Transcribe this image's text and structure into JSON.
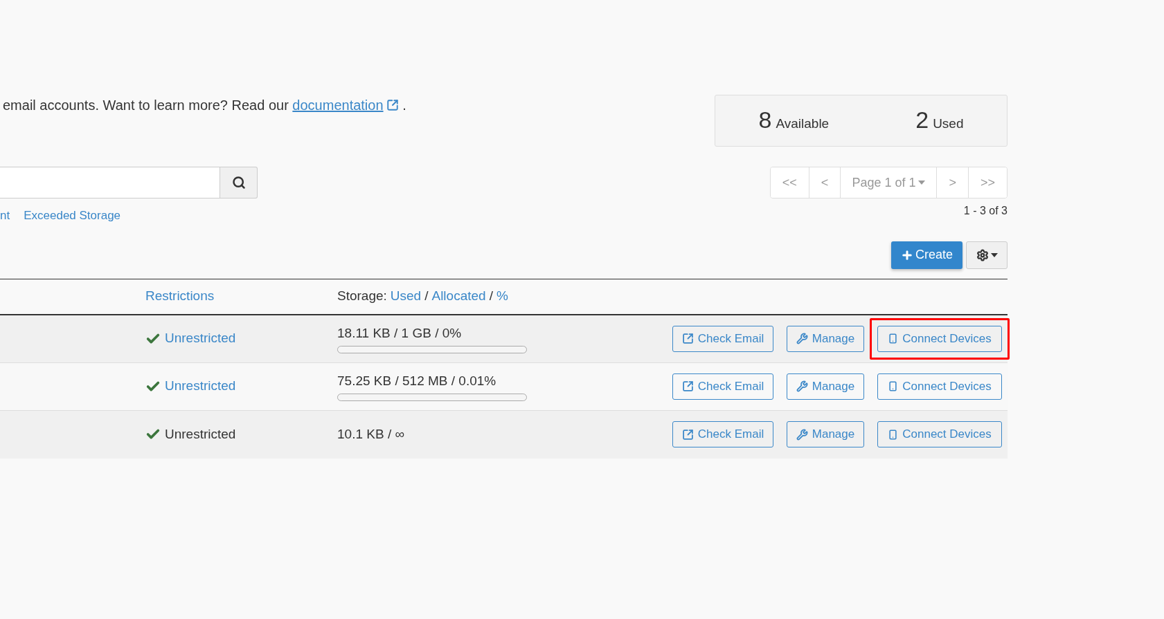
{
  "intro": {
    "text": "email accounts. Want to learn more? Read our",
    "link": "documentation",
    "end": "."
  },
  "stats": [
    {
      "value": "8",
      "label": "Available"
    },
    {
      "value": "2",
      "label": "Used"
    }
  ],
  "filters": [
    "nt",
    "Exceeded Storage"
  ],
  "pager": [
    {
      "kind": "button",
      "label": "<<"
    },
    {
      "kind": "button",
      "label": "<"
    },
    {
      "kind": "select",
      "label": "Page 1 of 1"
    },
    {
      "kind": "button",
      "label": ">"
    },
    {
      "kind": "button",
      "label": ">>"
    }
  ],
  "result_count": "1 - 3 of 3",
  "create_button": "Create",
  "table": {
    "header": {
      "restrictions": "Restrictions",
      "storage": [
        {
          "kind": "text",
          "text": "Storage:"
        },
        {
          "kind": "link",
          "text": "Used"
        },
        {
          "kind": "text",
          "text": "/"
        },
        {
          "kind": "link",
          "text": "Allocated"
        },
        {
          "kind": "text",
          "text": "/"
        },
        {
          "kind": "link",
          "text": "%"
        }
      ]
    },
    "rows": [
      {
        "restriction": "Unrestricted",
        "restriction_link": true,
        "storage": "18.11 KB / 1 GB / 0%",
        "level": 0,
        "actions": [
          {
            "kind": "check",
            "label": "Check Email",
            "highlighted": false
          },
          {
            "kind": "manage",
            "label": "Manage",
            "highlighted": false
          },
          {
            "kind": "devices",
            "label": "Connect Devices",
            "highlighted": true
          }
        ]
      },
      {
        "restriction": "Unrestricted",
        "restriction_link": true,
        "storage": "75.25 KB / 512 MB / 0.01%",
        "level": 0.0001,
        "actions": [
          {
            "kind": "check",
            "label": "Check Email",
            "highlighted": false
          },
          {
            "kind": "manage",
            "label": "Manage",
            "highlighted": false
          },
          {
            "kind": "devices",
            "label": "Connect Devices",
            "highlighted": false
          }
        ]
      },
      {
        "restriction": "Unrestricted",
        "restriction_link": false,
        "storage": "10.1 KB / ∞",
        "actions": [
          {
            "kind": "check",
            "label": "Check Email",
            "highlighted": false
          },
          {
            "kind": "manage",
            "label": "Manage",
            "highlighted": false
          },
          {
            "kind": "devices",
            "label": "Connect Devices",
            "highlighted": false
          }
        ]
      }
    ]
  }
}
